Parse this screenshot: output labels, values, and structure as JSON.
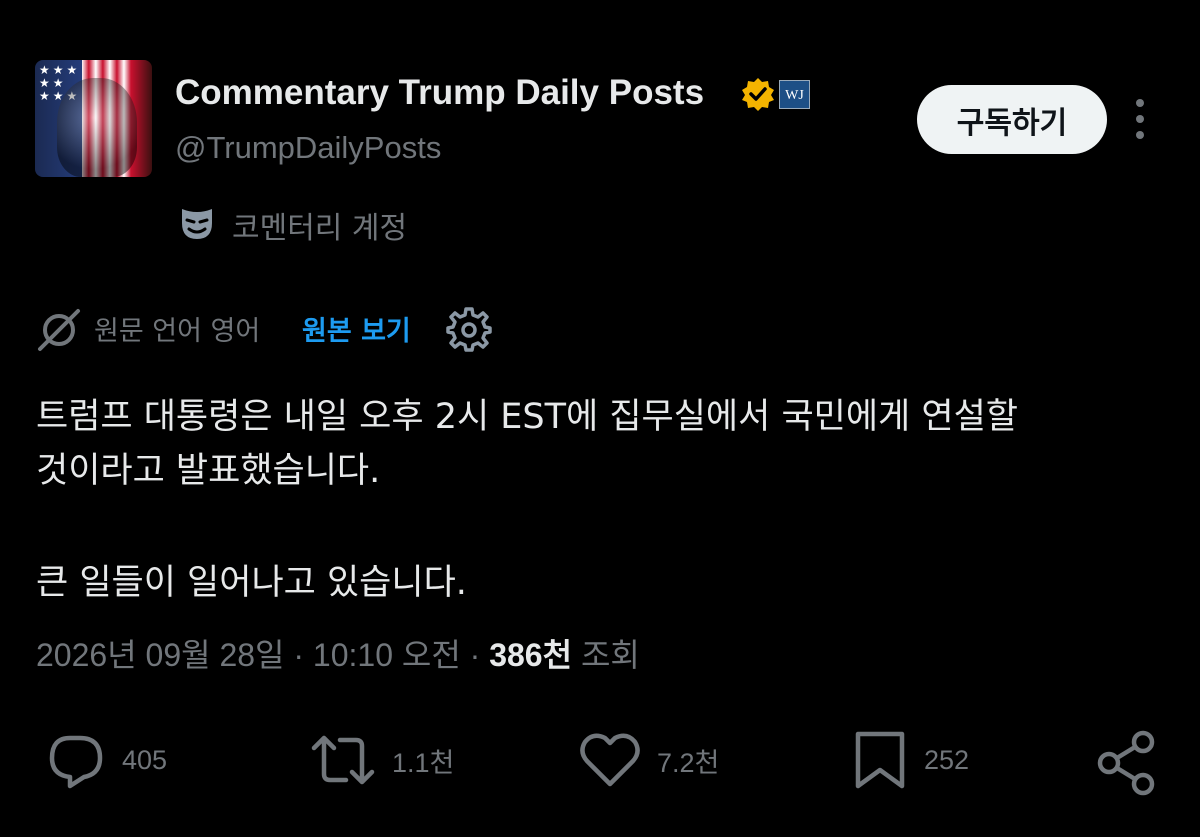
{
  "account": {
    "display_name": "Commentary Trump Daily Posts",
    "handle": "@TrumpDailyPosts",
    "affiliate_badge": "WJ",
    "verified_color": "#f4b400",
    "commentary_label": "코멘터리 계정",
    "commentary_icon": "mask-icon"
  },
  "header": {
    "subscribe_label": "구독하기",
    "more_icon": "more-vertical-icon"
  },
  "translation": {
    "source_language": "원문 언어 영어",
    "show_original": "원본 보기",
    "settings_icon": "gear-icon",
    "link_color": "#1d9bf0"
  },
  "tweet": {
    "line1": "트럼프 대통령은 내일 오후 2시 EST에 집무실에서 국민에게 연설할",
    "line2": "것이라고 발표했습니다.",
    "line3": "큰 일들이 일어나고 있습니다."
  },
  "meta": {
    "datetime": "2026년 09월 28일 · 10:10 오전 · ",
    "views": "386천",
    "views_label": " 조회"
  },
  "actions": {
    "replies": "405",
    "retweets": "1.1천",
    "likes": "7.2천",
    "bookmarks": "252"
  }
}
